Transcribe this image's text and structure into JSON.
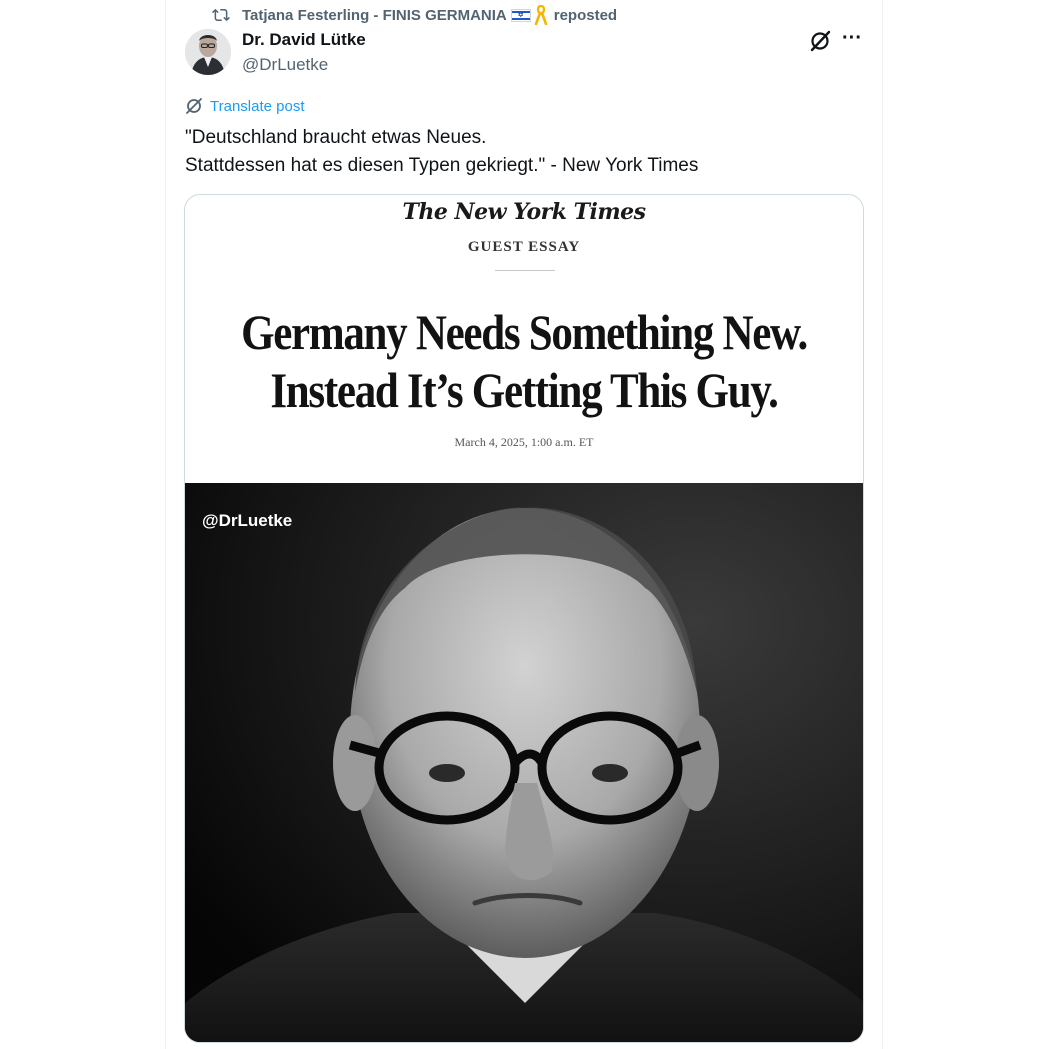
{
  "repost": {
    "reposter_name": "Tatjana Festerling - FINIS GERMANIA",
    "reposted_label": "reposted",
    "icon": "repost-icon"
  },
  "author": {
    "display_name": "Dr. David Lütke",
    "handle": "@DrLuetke"
  },
  "actions": {
    "grok_icon": "grok-icon",
    "more_label": "···"
  },
  "translate": {
    "label": "Translate post",
    "icon": "translate-icon"
  },
  "post": {
    "lines": [
      "\"Deutschland braucht etwas Neues.",
      "Stattdessen hat es diesen Typen gekriegt.\" - New York Times"
    ]
  },
  "media": {
    "masthead": "The New York Times",
    "section": "GUEST ESSAY",
    "headline_lines": [
      "Germany Needs Something New.",
      "Instead It’s Getting This Guy."
    ],
    "date": "March 4, 2025, 1:00 a.m. ET",
    "watermark": "@DrLuetke"
  },
  "colors": {
    "accent": "#1d9bf0",
    "text_primary": "#0f1419",
    "text_secondary": "#536471",
    "border": "#cfd9de"
  }
}
